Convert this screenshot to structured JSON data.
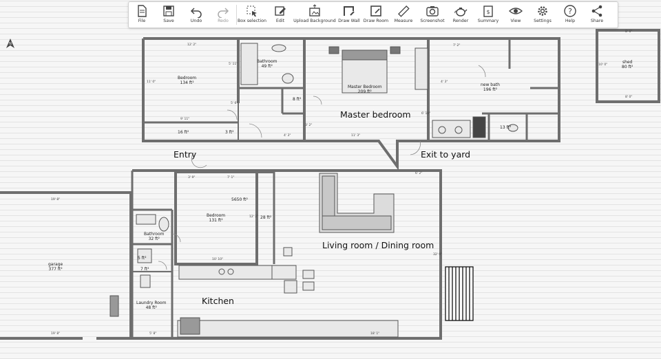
{
  "toolbar": {
    "file": "File",
    "save": "Save",
    "undo": "Undo",
    "redo": "Redo",
    "box_selection": "Box selection",
    "edit": "Edit",
    "upload_background": "Upload Background",
    "draw_wall": "Draw Wall",
    "draw_room": "Draw Room",
    "measure": "Measure",
    "screenshot": "Screenshot",
    "render": "Render",
    "summary": "Summary",
    "view": "View",
    "settings": "Settings",
    "help": "Help",
    "share": "Share"
  },
  "compass": "N",
  "rooms": {
    "bedroom1": {
      "name": "Bedroom",
      "area": "134 ft²"
    },
    "bathroom1": {
      "name": "Bathroom",
      "area": "49 ft²"
    },
    "master": {
      "name": "Master Bedroom",
      "area": "209 ft²"
    },
    "newbath": {
      "name": "new bath",
      "area": "196 ft²"
    },
    "shed": {
      "name": "shed",
      "area": "80 ft²"
    },
    "bedroom2": {
      "name": "Bedroom",
      "area": "131 ft²"
    },
    "bathroom2": {
      "name": "Bathroom",
      "area": "32 ft²"
    },
    "garage": {
      "name": "garage",
      "area": "377 ft²"
    },
    "laundry": {
      "name": "Laundry Room",
      "area": "48 ft²"
    },
    "closet1": {
      "area": "16 ft²"
    },
    "closet2": {
      "area": "8 ft²"
    },
    "closet3": {
      "area": "13 ft²"
    },
    "closet4": {
      "area": "3 ft²"
    },
    "closet5": {
      "area": "5 ft²"
    },
    "closet6": {
      "area": "7 ft²"
    },
    "small1": {
      "area": "5650 ft²"
    },
    "small2": {
      "area": "28 ft²"
    }
  },
  "labels": {
    "master_bedroom": "Master bedroom",
    "entry": "Entry",
    "exit_to_yard": "Exit to yard",
    "living": "Living room / Dining room",
    "kitchen": "Kitchen"
  },
  "dims": {
    "d1": "12' 2\"",
    "d2": "11' 0\"",
    "d3": "9' 11\"",
    "d4": "5' 6\"",
    "d5": "7' 2\"",
    "d6": "8' 0\"",
    "d7": "10' 0\"",
    "d8": "11' 3\"",
    "d9": "4' 3\"",
    "d10": "5' 11\"",
    "d11": "6' 2\"",
    "d12": "32' 9\"",
    "d13": "19' 8\"",
    "d14": "19' 8\"",
    "d15": "10' 10\"",
    "d16": "12' 2\"",
    "d17": "3' 9\"",
    "d18": "7' 1\"",
    "d19": "5' 8\"",
    "d20": "18' 1\"",
    "d21": "4' 3\"",
    "d22": "6' 10\"",
    "d23": "3' 2\"",
    "d24": "8' 0\""
  }
}
